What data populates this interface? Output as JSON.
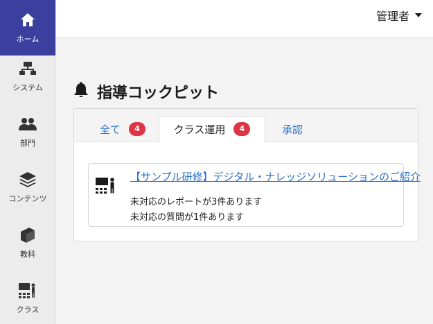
{
  "sidebar": {
    "items": [
      {
        "label": "ホーム",
        "icon": "home-icon",
        "active": true
      },
      {
        "label": "システム",
        "icon": "sitemap-icon",
        "active": false
      },
      {
        "label": "部門",
        "icon": "users-icon",
        "active": false
      },
      {
        "label": "コンテンツ",
        "icon": "layers-icon",
        "active": false
      },
      {
        "label": "教科",
        "icon": "book-icon",
        "active": false
      },
      {
        "label": "クラス",
        "icon": "teacher-icon",
        "active": false
      }
    ]
  },
  "header": {
    "user_label": "管理者"
  },
  "page": {
    "title": "指導コックピット"
  },
  "tabs": [
    {
      "label": "全て",
      "badge": "4",
      "active": false
    },
    {
      "label": "クラス運用",
      "badge": "4",
      "active": true
    },
    {
      "label": "承認",
      "badge": "",
      "active": false
    }
  ],
  "items": [
    {
      "title": "【サンプル研修】デジタル・ナレッジソリューションのご紹介",
      "lines": [
        "未対応のレポートが3件あります",
        "未対応の質問が1件あります"
      ]
    }
  ],
  "colors": {
    "accent": "#3b3f9e",
    "link": "#2a6ec6",
    "badge": "#dc3545"
  }
}
